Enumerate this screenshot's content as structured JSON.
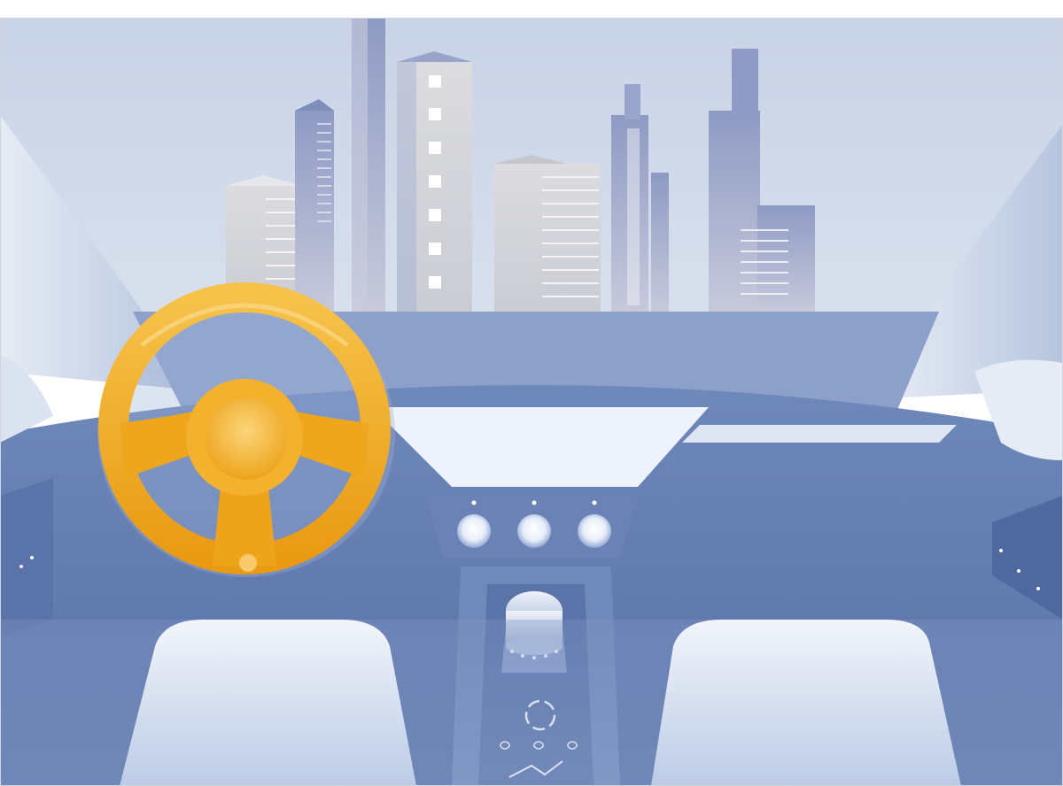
{
  "scene": {
    "colors": {
      "sky_top": "#c9d4e6",
      "sky_bottom": "#d7deeb",
      "building_gray": "#d3d4d8",
      "building_blue": "#8d99c3",
      "dash_dark": "#5f78ad",
      "dash_mid": "#7f96c4",
      "dash_light": "#c6d2e8",
      "wheel_gold": "#f0a91f",
      "wheel_gold_light": "#f8c857",
      "seat_light": "#e3e9f4"
    },
    "center_knob_count": 3,
    "gear_knob_light_count": 5
  }
}
